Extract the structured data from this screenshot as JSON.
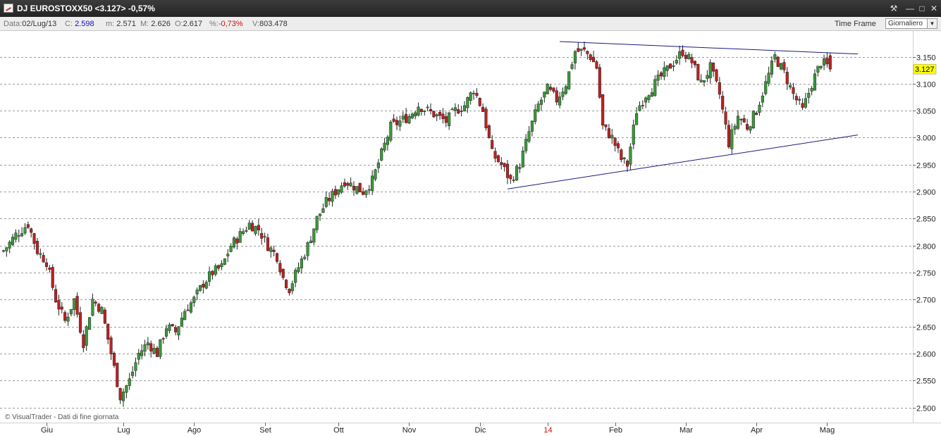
{
  "window": {
    "title": "DJ EUROSTOXX50 <3.127> -0,57%",
    "controls": [
      "tool-icon",
      "minimize-icon",
      "maximize-icon",
      "close-icon"
    ]
  },
  "infobar": {
    "data_label": "Data:",
    "data_value": "02/Lug/13",
    "c_label": "C:",
    "c_value": "2.598",
    "m_label": "m:",
    "m_value": "2.571",
    "M_label": "M:",
    "M_value": "2.626",
    "o_label": "O:",
    "o_value": "2.617",
    "pct_label": "%:",
    "pct_value": "-0,73%",
    "v_label": "V:",
    "v_value": "803.478",
    "timeframe_label": "Time Frame",
    "timeframe_value": "Giornaliero"
  },
  "credit": "© VisualTrader - Dati di fine giornata",
  "colors": {
    "up_candle": "#3a9a3a",
    "down_candle": "#c02020",
    "trendline": "#1a1a80",
    "last_price_badge": "#ffff00",
    "negative_text": "#d01010",
    "blue_value": "#1010c0"
  },
  "chart_data": {
    "type": "candlestick",
    "instrument": "DJ EUROSTOXX50",
    "last_price": "3.127",
    "ylim": [
      2.49,
      3.18
    ],
    "yticks": [
      "2.500",
      "2.550",
      "2.600",
      "2.650",
      "2.700",
      "2.750",
      "2.800",
      "2.850",
      "2.900",
      "2.950",
      "3.000",
      "3.050",
      "3.100",
      "3.150"
    ],
    "ytick_values": [
      2.5,
      2.55,
      2.6,
      2.65,
      2.7,
      2.75,
      2.8,
      2.85,
      2.9,
      2.95,
      3.0,
      3.05,
      3.1,
      3.15
    ],
    "grid": true,
    "x_ticks": [
      {
        "label": "Giu",
        "day": 0,
        "red": false
      },
      {
        "label": "Lug",
        "day": 25,
        "red": false
      },
      {
        "label": "Ago",
        "day": 48,
        "red": false
      },
      {
        "label": "Set",
        "day": 71,
        "red": false
      },
      {
        "label": "Ott",
        "day": 95,
        "red": false
      },
      {
        "label": "Nov",
        "day": 118,
        "red": false
      },
      {
        "label": "Dic",
        "day": 141,
        "red": false
      },
      {
        "label": "14",
        "day": 163,
        "red": true
      },
      {
        "label": "Feb",
        "day": 185,
        "red": false
      },
      {
        "label": "Mar",
        "day": 208,
        "red": false
      },
      {
        "label": "Apr",
        "day": 231,
        "red": false
      },
      {
        "label": "Mag",
        "day": 254,
        "red": false
      }
    ],
    "day_range": [
      -14,
      265
    ],
    "closes_keypoints": [
      [
        -14,
        2.79
      ],
      [
        -10,
        2.82
      ],
      [
        -6,
        2.84
      ],
      [
        -3,
        2.79
      ],
      [
        0,
        2.77
      ],
      [
        3,
        2.7
      ],
      [
        6,
        2.66
      ],
      [
        9,
        2.7
      ],
      [
        12,
        2.62
      ],
      [
        15,
        2.7
      ],
      [
        18,
        2.68
      ],
      [
        21,
        2.6
      ],
      [
        24,
        2.52
      ],
      [
        27,
        2.55
      ],
      [
        30,
        2.6
      ],
      [
        33,
        2.62
      ],
      [
        36,
        2.6
      ],
      [
        39,
        2.65
      ],
      [
        42,
        2.64
      ],
      [
        45,
        2.68
      ],
      [
        48,
        2.7
      ],
      [
        51,
        2.73
      ],
      [
        54,
        2.75
      ],
      [
        57,
        2.76
      ],
      [
        60,
        2.8
      ],
      [
        63,
        2.82
      ],
      [
        66,
        2.84
      ],
      [
        69,
        2.83
      ],
      [
        72,
        2.8
      ],
      [
        75,
        2.78
      ],
      [
        77,
        2.74
      ],
      [
        79,
        2.72
      ],
      [
        82,
        2.76
      ],
      [
        85,
        2.8
      ],
      [
        88,
        2.85
      ],
      [
        91,
        2.88
      ],
      [
        94,
        2.9
      ],
      [
        97,
        2.92
      ],
      [
        100,
        2.91
      ],
      [
        103,
        2.9
      ],
      [
        106,
        2.92
      ],
      [
        109,
        2.97
      ],
      [
        112,
        3.02
      ],
      [
        115,
        3.03
      ],
      [
        118,
        3.04
      ],
      [
        121,
        3.06
      ],
      [
        124,
        3.05
      ],
      [
        127,
        3.04
      ],
      [
        130,
        3.03
      ],
      [
        133,
        3.05
      ],
      [
        136,
        3.06
      ],
      [
        139,
        3.09
      ],
      [
        142,
        3.05
      ],
      [
        145,
        2.97
      ],
      [
        148,
        2.95
      ],
      [
        151,
        2.92
      ],
      [
        154,
        2.95
      ],
      [
        157,
        3.01
      ],
      [
        160,
        3.06
      ],
      [
        163,
        3.09
      ],
      [
        166,
        3.07
      ],
      [
        169,
        3.1
      ],
      [
        172,
        3.16
      ],
      [
        175,
        3.16
      ],
      [
        177,
        3.15
      ],
      [
        179,
        3.13
      ],
      [
        181,
        3.02
      ],
      [
        184,
        3.0
      ],
      [
        187,
        2.96
      ],
      [
        189,
        2.95
      ],
      [
        192,
        3.05
      ],
      [
        195,
        3.08
      ],
      [
        198,
        3.1
      ],
      [
        201,
        3.12
      ],
      [
        204,
        3.14
      ],
      [
        207,
        3.16
      ],
      [
        210,
        3.14
      ],
      [
        213,
        3.1
      ],
      [
        216,
        3.13
      ],
      [
        219,
        3.08
      ],
      [
        222,
        2.99
      ],
      [
        225,
        3.04
      ],
      [
        228,
        3.02
      ],
      [
        231,
        3.05
      ],
      [
        234,
        3.1
      ],
      [
        237,
        3.15
      ],
      [
        240,
        3.12
      ],
      [
        243,
        3.08
      ],
      [
        246,
        3.05
      ],
      [
        249,
        3.1
      ],
      [
        252,
        3.14
      ],
      [
        255,
        3.13
      ]
    ],
    "trendlines": [
      {
        "from": [
          167,
          3.178
        ],
        "to": [
          264,
          3.155
        ]
      },
      {
        "from": [
          150,
          2.905
        ],
        "to": [
          264,
          3.005
        ]
      }
    ]
  }
}
